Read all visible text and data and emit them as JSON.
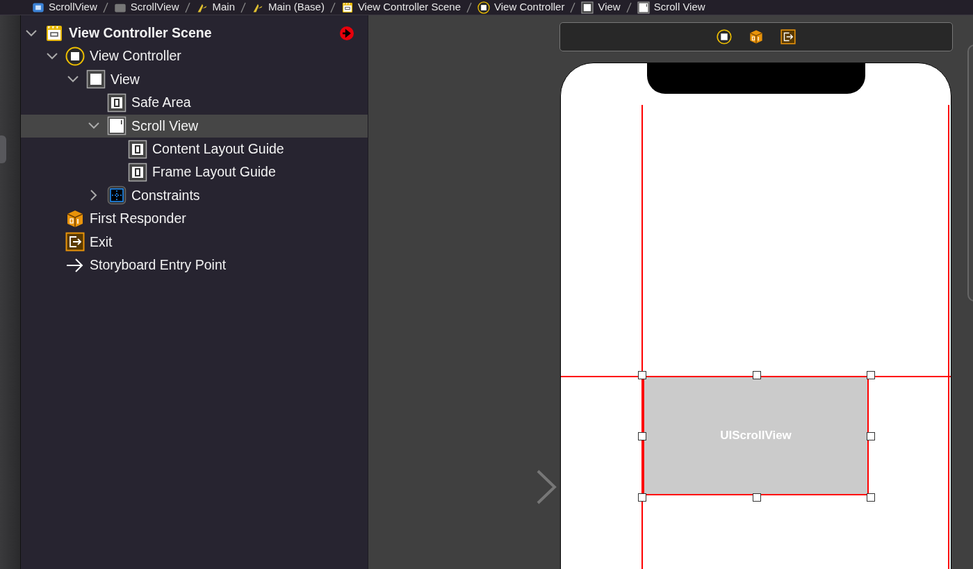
{
  "breadcrumbs": [
    {
      "kind": "project",
      "label": "ScrollView"
    },
    {
      "kind": "folder",
      "label": "ScrollView"
    },
    {
      "kind": "storyboard",
      "label": "Main"
    },
    {
      "kind": "storyboard",
      "label": "Main (Base)"
    },
    {
      "kind": "scene",
      "label": "View Controller Scene"
    },
    {
      "kind": "controller",
      "label": "View Controller"
    },
    {
      "kind": "view",
      "label": "View"
    },
    {
      "kind": "scroll-view",
      "label": "Scroll View"
    }
  ],
  "outline": [
    {
      "kind": "scene",
      "label": "View Controller Scene",
      "expanded": true,
      "selected": false,
      "children": [
        {
          "kind": "controller",
          "label": "View Controller",
          "expanded": true,
          "selected": false,
          "children": [
            {
              "kind": "view",
              "label": "View",
              "expanded": true,
              "selected": false,
              "children": [
                {
                  "kind": "guide",
                  "label": "Safe Area",
                  "selected": false
                },
                {
                  "kind": "scroll-view",
                  "label": "Scroll View",
                  "expanded": true,
                  "selected": true,
                  "children": [
                    {
                      "kind": "guide",
                      "label": "Content Layout Guide",
                      "selected": false
                    },
                    {
                      "kind": "guide",
                      "label": "Frame Layout Guide",
                      "selected": false
                    }
                  ]
                },
                {
                  "kind": "constraints",
                  "label": "Constraints",
                  "expanded": false,
                  "selected": false
                }
              ]
            }
          ]
        },
        {
          "kind": "responder",
          "label": "First Responder",
          "selected": false
        },
        {
          "kind": "exit",
          "label": "Exit",
          "selected": false
        },
        {
          "kind": "entry",
          "label": "Storyboard Entry Point",
          "selected": false
        }
      ]
    }
  ],
  "canvas": {
    "scroll_view_label": "UIScrollView"
  }
}
